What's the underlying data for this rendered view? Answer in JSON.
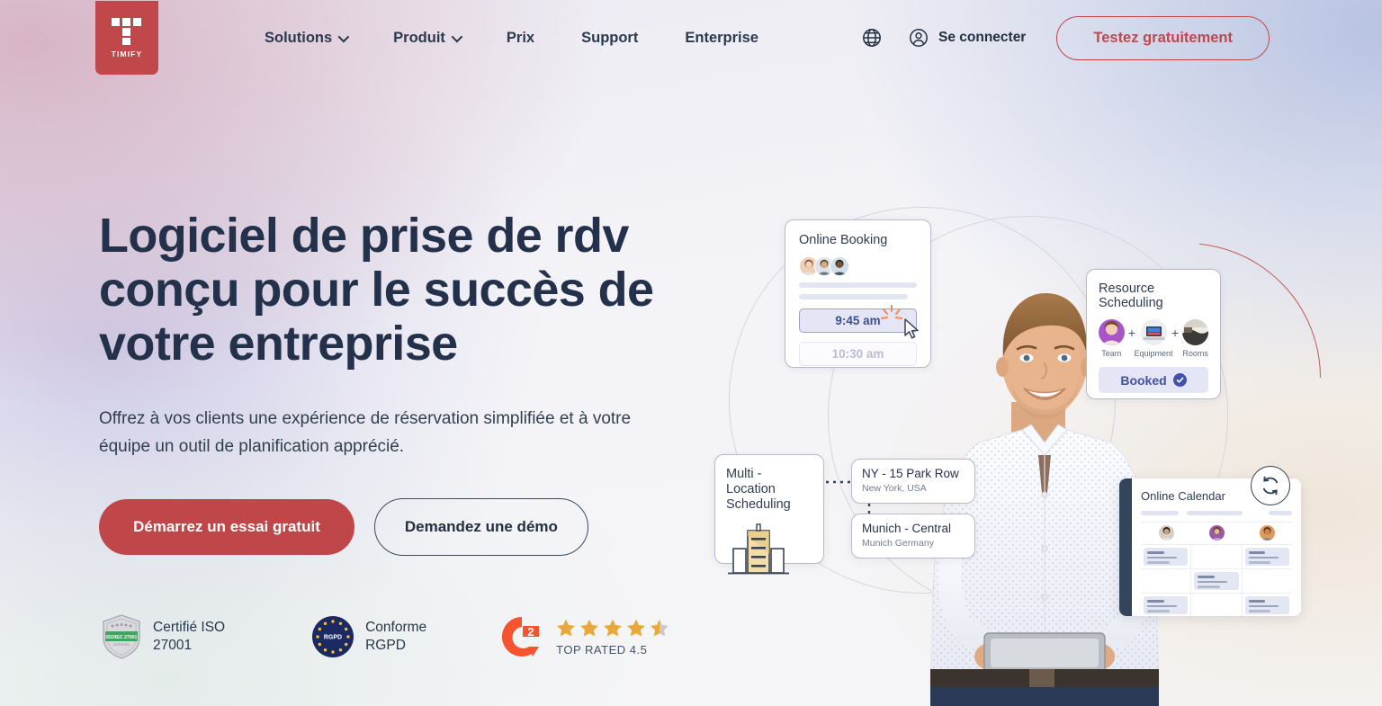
{
  "brand": {
    "name": "TIMIFY",
    "logo_icon": "timify-t-logo",
    "primary_color": "#bf4749",
    "dark_color": "#23314a"
  },
  "header": {
    "nav": [
      {
        "label": "Solutions",
        "has_dropdown": true
      },
      {
        "label": "Produit",
        "has_dropdown": true
      },
      {
        "label": "Prix",
        "has_dropdown": false
      },
      {
        "label": "Support",
        "has_dropdown": false
      },
      {
        "label": "Enterprise",
        "has_dropdown": false
      }
    ],
    "language_icon": "globe-icon",
    "login_icon": "user-circle-icon",
    "login_label": "Se connecter",
    "cta_label": "Testez gratuitement"
  },
  "hero": {
    "headline": "Logiciel de prise de rdv conçu pour le succès de votre entreprise",
    "subhead": "Offrez à vos clients une expérience de réservation simplifiée et à votre équipe un outil de planification apprécié.",
    "primary_cta": "Démarrez un essai gratuit",
    "secondary_cta": "Demandez une démo"
  },
  "badges": [
    {
      "icon": "iso-shield-badge-icon",
      "line1": "Certifié ISO",
      "line2": "27001"
    },
    {
      "icon": "gdpr-eu-stars-icon",
      "line1": "Conforme",
      "line2": "RGPD",
      "inner_label": "RGPD"
    },
    {
      "icon": "g2-logo-icon",
      "rating": 4.5,
      "stars_full": 4,
      "stars_half": 1,
      "caption": "TOP RATED 4.5",
      "star_color": "#e8a93a"
    }
  ],
  "illustration": {
    "person_alt": "smiling-man-holding-tablet",
    "booking_card": {
      "title": "Online Booking",
      "avatars": [
        "avatar-1",
        "avatar-2",
        "avatar-3"
      ],
      "slot_selected": "9:45 am",
      "slot_other": "10:30 am",
      "cursor_icon": "mouse-pointer-icon",
      "spark_icon": "click-spark-icon"
    },
    "resource_card": {
      "title": "Resource Scheduling",
      "items": [
        {
          "label": "Team",
          "icon": "team-avatar-icon"
        },
        {
          "label": "Equipment",
          "icon": "laptop-icon"
        },
        {
          "label": "Rooms",
          "icon": "room-photo-icon"
        }
      ],
      "separator": "+",
      "status_label": "Booked",
      "status_icon": "check-circle-icon"
    },
    "multi_location_card": {
      "title_line1": "Multi - Location",
      "title_line2": "Scheduling",
      "icon": "office-building-icon"
    },
    "locations": [
      {
        "name": "NY - 15 Park Row",
        "sub": "New York, USA"
      },
      {
        "name": "Munich - Central",
        "sub": "Munich Germany"
      }
    ],
    "calendar_card": {
      "title": "Online Calendar",
      "staff_avatars": [
        "staff-1",
        "staff-2",
        "staff-3"
      ],
      "sync_icon": "sync-refresh-icon",
      "rows": [
        [
          true,
          false,
          true
        ],
        [
          false,
          true,
          false
        ],
        [
          true,
          false,
          true
        ]
      ]
    }
  }
}
